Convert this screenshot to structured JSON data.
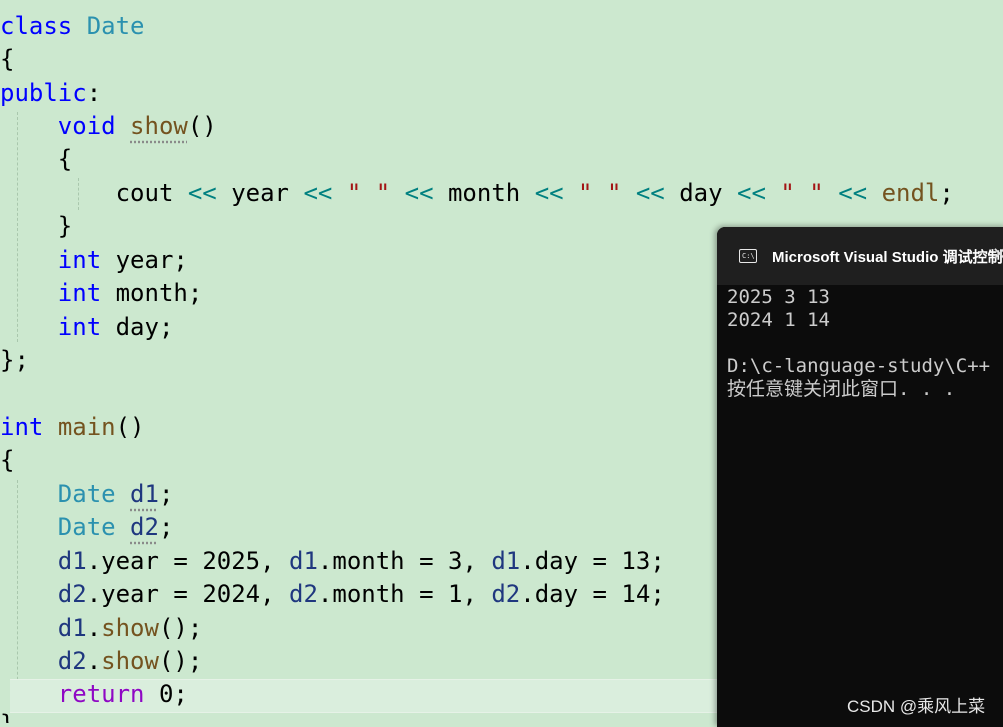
{
  "code": {
    "lines": [
      {
        "class": "tok-line"
      }
    ],
    "tokens": {
      "class_kw": "class",
      "class_name": "Date",
      "open_brace": "{",
      "close_brace": "}",
      "close_class": "};",
      "public_kw": "public",
      "colon": ":",
      "void_kw": "void",
      "show_fn": "show",
      "parens": "()",
      "semicolon": ";",
      "cout": "cout",
      "shift": "<<",
      "year": "year",
      "month": "month",
      "day": "day",
      "space_str": "\" \"",
      "endl": "endl",
      "int_kw": "int",
      "main_fn": "main",
      "d1": "d1",
      "d2": "d2",
      "dot": ".",
      "eq": "=",
      "comma": ",",
      "num_2025": "2025",
      "num_3": "3",
      "num_13": "13",
      "num_2024": "2024",
      "num_1": "1",
      "num_14": "14",
      "return_kw": "return",
      "num_0": "0"
    }
  },
  "console": {
    "title": "Microsoft Visual Studio 调试控制台",
    "output": [
      "2025 3 13",
      "2024 1 14",
      "",
      "D:\\c-language-study\\C++",
      "按任意键关闭此窗口. . ."
    ]
  },
  "watermark": "CSDN @乘风上菜"
}
